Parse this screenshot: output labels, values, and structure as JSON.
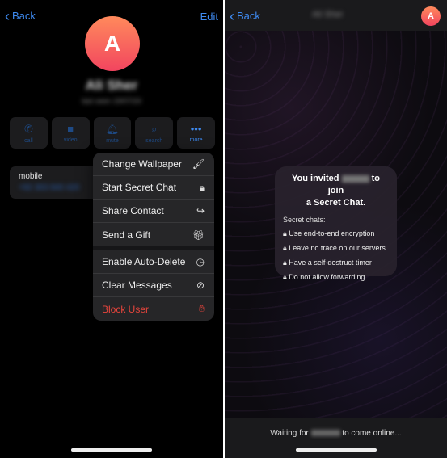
{
  "left": {
    "back_label": "Back",
    "edit_label": "Edit",
    "avatar_letter": "A",
    "name": "Ali Sher",
    "last_seen": "last seen 19/07/24",
    "actions": [
      {
        "label": "call",
        "icon": "phone-icon"
      },
      {
        "label": "video",
        "icon": "video-icon"
      },
      {
        "label": "mute",
        "icon": "bell-icon"
      },
      {
        "label": "search",
        "icon": "search-icon"
      },
      {
        "label": "more",
        "icon": "more-icon"
      }
    ],
    "mobile_label": "mobile",
    "phone": "+92 303 840 420",
    "menu": [
      {
        "label": "Change Wallpaper",
        "icon": "brush-icon"
      },
      {
        "label": "Start Secret Chat",
        "icon": "lock-icon"
      },
      {
        "label": "Share Contact",
        "icon": "share-icon"
      },
      {
        "label": "Send a Gift",
        "icon": "gift-icon"
      },
      {
        "label": "Enable Auto-Delete",
        "icon": "timer-icon"
      },
      {
        "label": "Clear Messages",
        "icon": "clear-icon"
      },
      {
        "label": "Block User",
        "icon": "hand-icon"
      }
    ],
    "danger_color": "#e8453c",
    "accent": "#3e8af0"
  },
  "right": {
    "back_label": "Back",
    "title": "Ali Sher",
    "avatar_letter": "A",
    "invite_prefix": "You invited",
    "invite_suffix": "to join",
    "invite_line2": "a Secret Chat.",
    "features_heading": "Secret chats:",
    "features": [
      "Use end-to-end encryption",
      "Leave no trace on our servers",
      "Have a self-destruct timer",
      "Do not allow forwarding"
    ],
    "waiting_prefix": "Waiting for",
    "waiting_suffix": "to come online..."
  }
}
